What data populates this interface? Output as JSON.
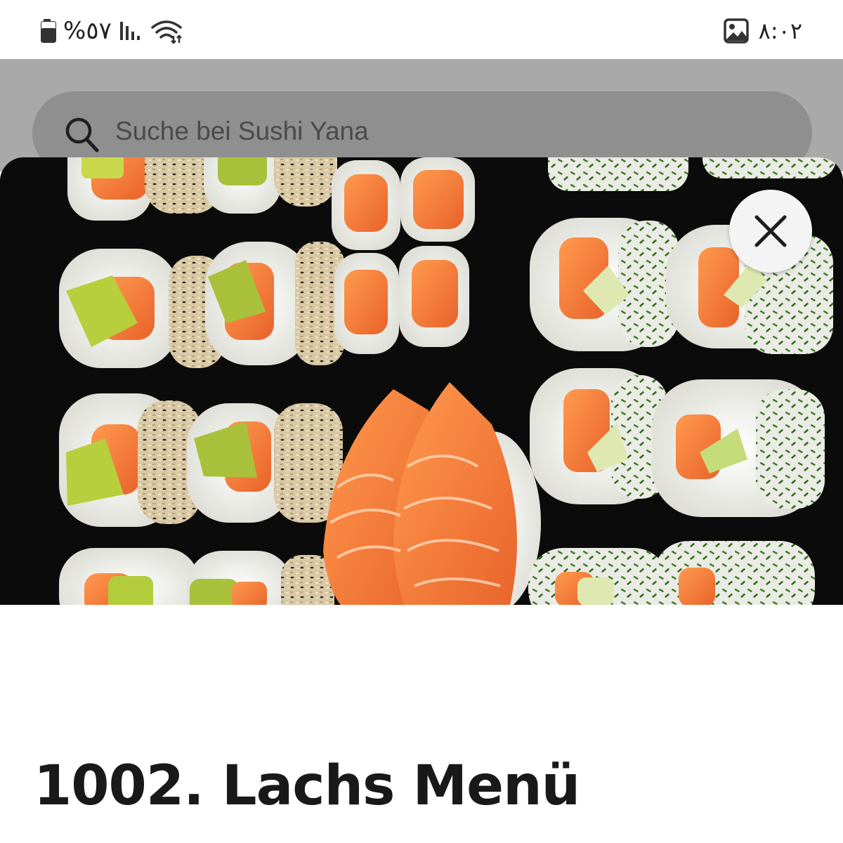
{
  "status_bar": {
    "battery_percent_text": "%٥٧",
    "time": "٨:٠٢",
    "icons": [
      "battery-icon",
      "signal-icon",
      "wifi-icon",
      "gallery-icon"
    ]
  },
  "search": {
    "placeholder": "Suche bei Sushi Yana"
  },
  "product": {
    "title": "1002. Lachs Menü",
    "image_alt": "Sushi platter with salmon maki, avocado sesame rolls and salmon nigiri"
  },
  "close": {
    "icon": "close-icon"
  },
  "colors": {
    "scrim": "#a9a9a9",
    "search_bg": "#8f8f8f",
    "title": "#191919",
    "salmon": "#f07a3a",
    "avocado": "#b8cf3a"
  }
}
